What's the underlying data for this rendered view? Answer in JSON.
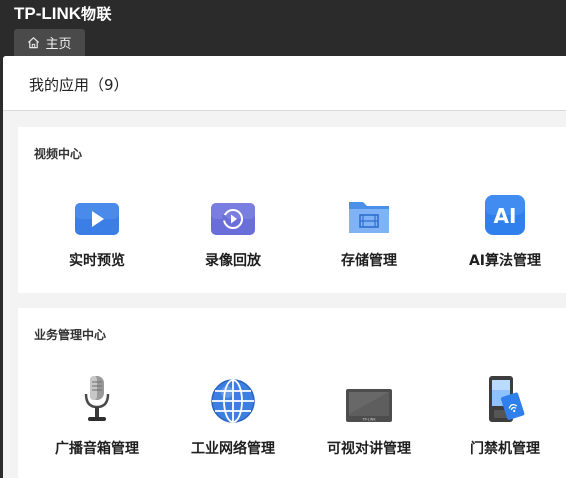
{
  "header": {
    "brand_main": "TP-LINK",
    "brand_sub": "物联",
    "home_tab_label": "主页"
  },
  "apps": {
    "title": "我的应用（9）"
  },
  "video_center": {
    "title": "视频中心",
    "items": [
      {
        "label": "实时预览",
        "icon": "play-video-icon"
      },
      {
        "label": "录像回放",
        "icon": "playback-icon"
      },
      {
        "label": "存储管理",
        "icon": "storage-folder-icon"
      },
      {
        "label": "AI算法管理",
        "icon": "ai-icon"
      }
    ]
  },
  "business_center": {
    "title": "业务管理中心",
    "items": [
      {
        "label": "广播音箱管理",
        "icon": "microphone-icon"
      },
      {
        "label": "工业网络管理",
        "icon": "network-globe-icon"
      },
      {
        "label": "可视对讲管理",
        "icon": "intercom-screen-icon"
      },
      {
        "label": "门禁机管理",
        "icon": "access-control-icon"
      }
    ]
  },
  "colors": {
    "topbar": "#2b2b2b",
    "tab": "#4a4a4a",
    "accent_blue": "#3b7ee6",
    "ai_blue": "#2f80ed"
  }
}
